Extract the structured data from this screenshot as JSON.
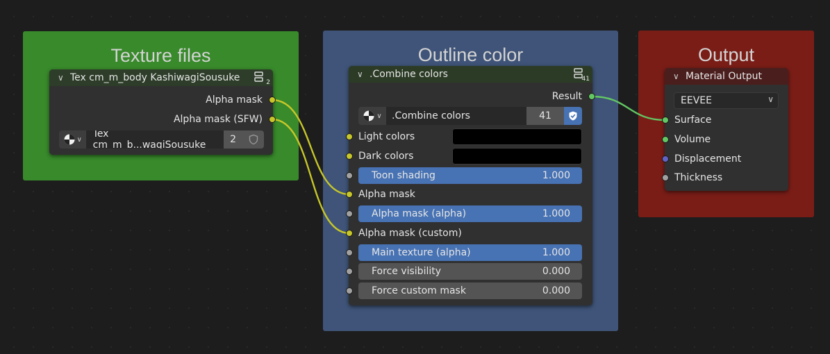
{
  "frames": {
    "texture_files": {
      "title": "Texture files",
      "color": "#388a2b"
    },
    "outline_color": {
      "title": "Outline color",
      "color": "#3f5478"
    },
    "output": {
      "title": "Output",
      "color": "#7a1d17"
    }
  },
  "tex_node": {
    "title": "Tex cm_m_body KashiwagiSousuke",
    "header_color": "#2d3d29",
    "user_count_badge": "2",
    "outputs": [
      "Alpha mask",
      "Alpha mask (SFW)"
    ],
    "selector": {
      "name": "Tex cm_m_b...wagiSousuke",
      "users": "2",
      "icon": "node-tree-icon"
    }
  },
  "combine_node": {
    "title": ".Combine colors",
    "header_color": "#2c3b26",
    "user_count_badge": "41",
    "output": "Result",
    "selector": {
      "name": ".Combine colors",
      "users": "41",
      "icon": "node-tree-icon"
    },
    "inputs": {
      "light_colors": "Light colors",
      "dark_colors": "Dark colors",
      "toon_shading": {
        "label": "Toon shading",
        "value": "1.000"
      },
      "alpha_mask": "Alpha mask",
      "alpha_mask_alpha": {
        "label": "Alpha mask (alpha)",
        "value": "1.000"
      },
      "alpha_mask_custom": "Alpha mask (custom)",
      "main_texture_alpha": {
        "label": "Main texture (alpha)",
        "value": "1.000"
      },
      "force_visibility": {
        "label": "Force visibility",
        "value": "0.000"
      },
      "force_custom_mask": {
        "label": "Force custom mask",
        "value": "0.000"
      }
    }
  },
  "output_node": {
    "title": "Material Output",
    "header_color": "#4a1e1d",
    "target": "EEVEE",
    "inputs": [
      "Surface",
      "Volume",
      "Displacement",
      "Thickness"
    ]
  },
  "colors": {
    "float_socket": "#a1a1a1",
    "color_socket": "#c7c729",
    "shader_socket": "#63c763",
    "vector_socket": "#6363c7",
    "slider_blue": "#4772b3",
    "fake_user_blue": "#4772b3"
  }
}
